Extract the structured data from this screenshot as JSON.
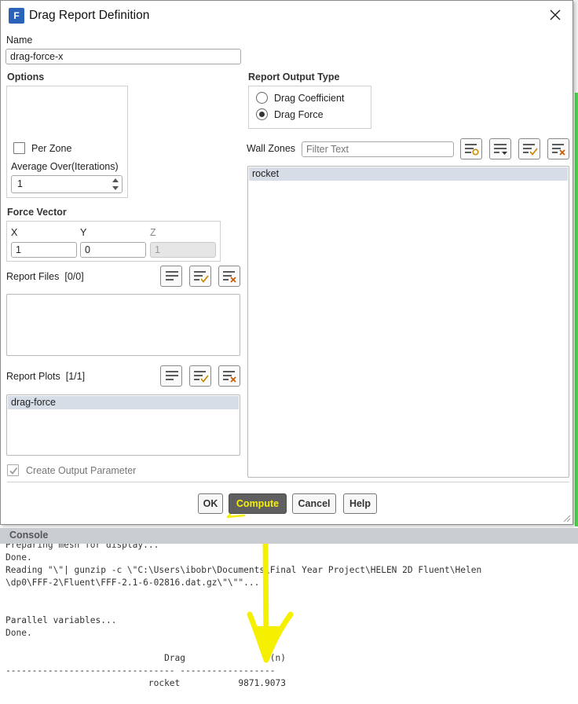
{
  "window": {
    "title": "Drag Report Definition",
    "app_icon_letter": "F"
  },
  "name_field": {
    "label": "Name",
    "value": "drag-force-x"
  },
  "options": {
    "title": "Options",
    "per_zone_label": "Per Zone",
    "per_zone_checked": false,
    "average_label": "Average Over(Iterations)",
    "average_value": "1"
  },
  "report_output_type": {
    "title": "Report Output Type",
    "options": [
      {
        "label": "Drag Coefficient",
        "selected": false
      },
      {
        "label": "Drag Force",
        "selected": true
      }
    ]
  },
  "wall_zones": {
    "label": "Wall Zones",
    "filter_placeholder": "Filter Text",
    "items": [
      "rocket"
    ]
  },
  "force_vector": {
    "title": "Force Vector",
    "x_label": "X",
    "y_label": "Y",
    "z_label": "Z",
    "x_value": "1",
    "y_value": "0",
    "z_value": "1"
  },
  "report_files": {
    "label": "Report Files",
    "count": "[0/0]",
    "items": []
  },
  "report_plots": {
    "label": "Report Plots",
    "count": "[1/1]",
    "items": [
      "drag-force"
    ]
  },
  "create_output_parameter": {
    "label": "Create Output Parameter",
    "checked": true,
    "enabled": false
  },
  "buttons": {
    "ok": "OK",
    "compute": "Compute",
    "cancel": "Cancel",
    "help": "Help"
  },
  "console": {
    "title": "Console",
    "lines": [
      "Preparing mesh for display...",
      "Done.",
      "Reading \"\\\"| gunzip -c \\\"C:\\Users\\ibobr\\Documents\\Final Year Project\\HELEN 2D Fluent\\Helen",
      "\\dp0\\FFF-2\\Fluent\\FFF-2.1-6-02816.dat.gz\\\"\\\"\"...",
      "",
      "",
      "Parallel variables...",
      "Done.",
      "",
      "                              Drag                (n)",
      "-------------------------------- ------------------",
      "                           rocket           9871.9073"
    ]
  },
  "colors": {
    "compute_bg": "#5f5f5f",
    "compute_text": "#f7f100",
    "annotation": "#f5f000",
    "accent_blue": "#2a63b7"
  }
}
